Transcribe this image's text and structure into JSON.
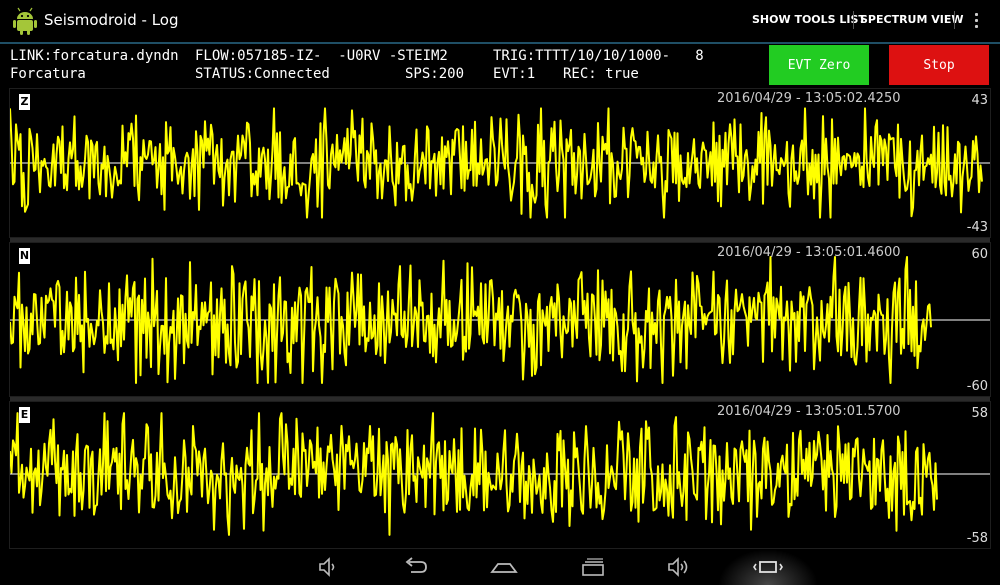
{
  "app": {
    "title": "Seismodroid - Log",
    "icon": "android-robot-icon",
    "accent_color": "#a4c639"
  },
  "actionbar": {
    "show_tools_list": "SHOW TOOLS LIST",
    "spectrum_view": "SPECTRUM VIEW",
    "overflow_icon": "overflow-menu-icon"
  },
  "info": {
    "link": "LINK:forcatura.dyndn",
    "flow": "FLOW:057185-IZ-  -U0RV -STEIM2",
    "trig": "TRIG:TTTT/10/10/1000-   8",
    "station": "Forcatura",
    "status": "STATUS:Connected",
    "sps": "SPS:200",
    "evt": "EVT:1",
    "rec": "REC: true"
  },
  "buttons": {
    "evt_zero": "EVT Zero",
    "stop": "Stop",
    "evt_zero_color": "#22cc22",
    "stop_color": "#dd1111"
  },
  "channels": [
    {
      "label": "Z",
      "timestamp": "2016/04/29 - 13:05:02.4250",
      "max": "43",
      "min": "-43",
      "trace_color": "#ffff00"
    },
    {
      "label": "N",
      "timestamp": "2016/04/29 - 13:05:01.4600",
      "max": "60",
      "min": "-60",
      "trace_color": "#ffff00"
    },
    {
      "label": "E",
      "timestamp": "2016/04/29 - 13:05:01.5700",
      "max": "58",
      "min": "-58",
      "trace_color": "#ffff00"
    }
  ],
  "navbar": {
    "icons": [
      "volume-down-icon",
      "back-icon",
      "home-icon",
      "recent-apps-icon",
      "volume-up-icon",
      "screen-resize-icon"
    ]
  }
}
